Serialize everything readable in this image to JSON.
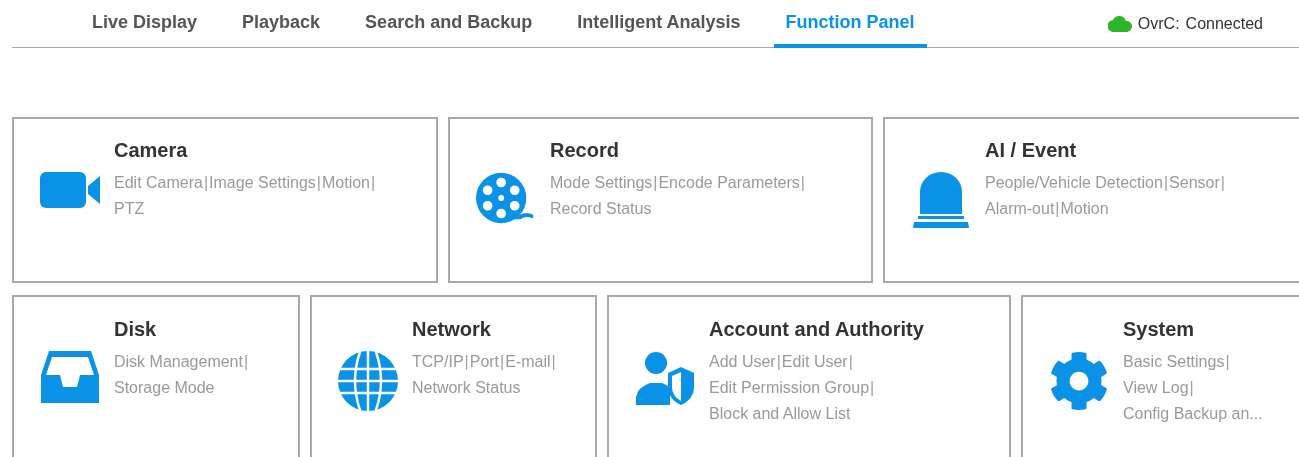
{
  "tabs": [
    {
      "label": "Live Display",
      "selected": false
    },
    {
      "label": "Playback",
      "selected": false
    },
    {
      "label": "Search and Backup",
      "selected": false
    },
    {
      "label": "Intelligent Analysis",
      "selected": false
    },
    {
      "label": "Function Panel",
      "selected": true
    }
  ],
  "cloud_status": {
    "label": "OvrC:",
    "status": "Connected"
  },
  "separator": "|",
  "panel_rows": [
    {
      "panels": [
        {
          "title": "Camera",
          "lines": [
            [
              "Edit Camera",
              "Image Settings",
              "Motion"
            ],
            [
              "PTZ"
            ]
          ]
        },
        {
          "title": "Record",
          "lines": [
            [
              "Mode Settings",
              "Encode Parameters"
            ],
            [
              "Record Status"
            ]
          ]
        },
        {
          "title": "AI / Event",
          "lines": [
            [
              "People/Vehicle Detection",
              "Sensor"
            ],
            [
              "Alarm-out",
              "Motion"
            ]
          ]
        }
      ]
    },
    {
      "panels": [
        {
          "title": "Disk",
          "lines": [
            [
              "Disk Management"
            ],
            [
              "Storage Mode"
            ]
          ]
        },
        {
          "title": "Network",
          "lines": [
            [
              "TCP/IP",
              "Port",
              "E-mail"
            ],
            [
              "Network Status"
            ]
          ]
        },
        {
          "title": "Account and Authority",
          "lines": [
            [
              "Add User",
              "Edit User"
            ],
            [
              "Edit Permission Group"
            ],
            [
              "Block and Allow List"
            ]
          ]
        },
        {
          "title": "System",
          "lines": [
            [
              "Basic Settings"
            ],
            [
              "View Log"
            ],
            [
              "Config Backup an..."
            ]
          ]
        }
      ]
    }
  ]
}
